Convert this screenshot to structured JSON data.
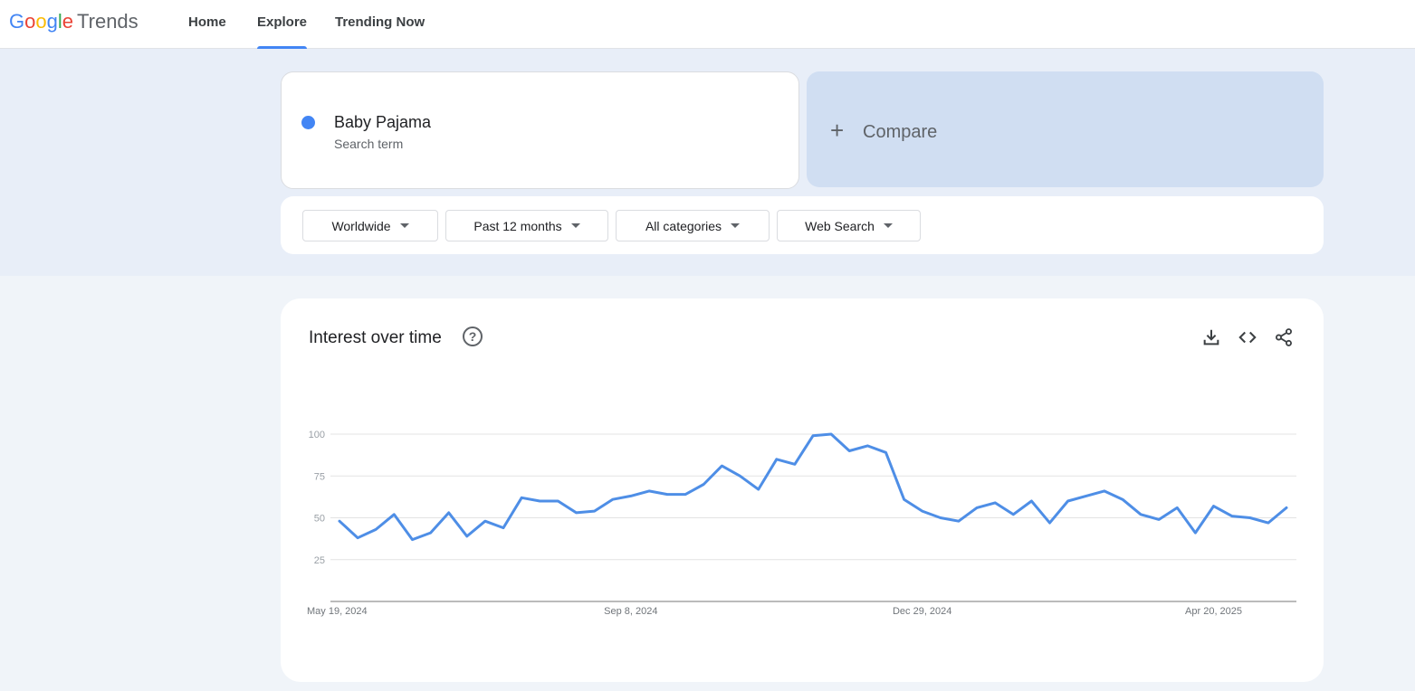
{
  "app": {
    "logo_google": [
      "G",
      "o",
      "o",
      "g",
      "l",
      "e"
    ],
    "logo_product": "Trends"
  },
  "nav": {
    "items": [
      {
        "label": "Home"
      },
      {
        "label": "Explore"
      },
      {
        "label": "Trending Now"
      }
    ],
    "active": "Explore"
  },
  "search_term": {
    "name": "Baby Pajama",
    "type": "Search term",
    "color": "#4285f4"
  },
  "compare": {
    "label": "Compare",
    "icon": "plus-icon"
  },
  "filters": {
    "region": "Worldwide",
    "time_range": "Past 12 months",
    "category": "All categories",
    "search_type": "Web Search"
  },
  "interest_card": {
    "title": "Interest over time",
    "icons": [
      "help-icon",
      "download-icon",
      "embed-icon",
      "share-icon"
    ]
  },
  "chart_data": {
    "type": "line",
    "ylim": [
      0,
      100
    ],
    "yticks": [
      25,
      50,
      75,
      100
    ],
    "xtick_labels": [
      "May 19, 2024",
      "Sep 8, 2024",
      "Dec 29, 2024",
      "Apr 20, 2025"
    ],
    "grid": true,
    "series": [
      {
        "color": "#4e8ee6",
        "values": [
          48,
          38,
          43,
          52,
          37,
          41,
          53,
          39,
          48,
          44,
          62,
          60,
          60,
          53,
          54,
          61,
          63,
          66,
          64,
          64,
          70,
          81,
          75,
          67,
          85,
          82,
          99,
          100,
          90,
          93,
          89,
          61,
          54,
          50,
          48,
          56,
          59,
          52,
          60,
          47,
          60,
          63,
          66,
          61,
          52,
          49,
          56,
          41,
          57,
          51,
          50,
          47,
          56
        ]
      }
    ]
  }
}
